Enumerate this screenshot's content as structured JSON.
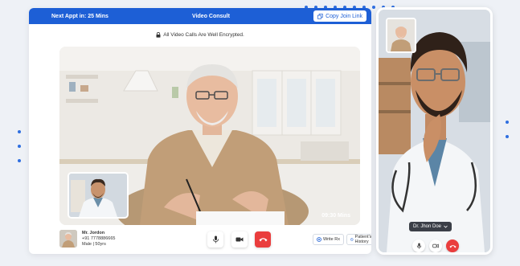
{
  "header": {
    "next_appt": "Next Appt in: 25 Mins",
    "title": "Video Consult",
    "copy_link_label": "Copy Join Link"
  },
  "encryption_notice": "All Video Calls Are Well Encrypted.",
  "main_video": {
    "duration": "09:30 Mins"
  },
  "patient": {
    "name": "Mr. Jordon",
    "phone": "+91 7778886665",
    "details": "Male | 50yrs"
  },
  "controls": {
    "write_rx_label": "Write Rx",
    "history_label": "Patient's History"
  },
  "doctor_phone": {
    "name": "Dr. Jhon Doe"
  },
  "colors": {
    "primary": "#1d5fd6",
    "end_call": "#ea3d3d"
  }
}
